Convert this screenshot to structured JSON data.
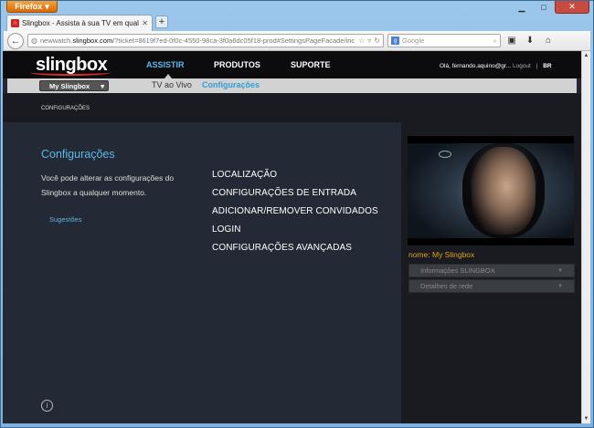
{
  "browser": {
    "app_button": "Firefox",
    "tab_title": "Slingbox - Assista à sua TV em qualquer ...",
    "url_prefix": "newwatch.",
    "url_domain": "slingbox.com",
    "url_path": "/?ticket=8619f7ed-0f0c-4550-98ca-3f0a6dc05f18-prod#SettingsPageFacade/inc",
    "search_placeholder": "Google"
  },
  "header": {
    "logo": "slingbox",
    "nav": [
      "ASSISTIR",
      "PRODUTOS",
      "SUPORTE"
    ],
    "greeting": "Olá, fernando.aquino@gr...",
    "logout": "Logout",
    "separator": "|",
    "language": "BR"
  },
  "subnav": {
    "device_select": "My Slingbox",
    "links": [
      "TV ao Vivo",
      "Configurações"
    ]
  },
  "breadcrumb": "CONFIGURAÇÕES",
  "main": {
    "title": "Configurações",
    "description": "Você pode alterar as configurações do Slingbox a qualquer momento.",
    "suggestions": "Sugestões",
    "menu": [
      "LOCALIZAÇÃO",
      "CONFIGURAÇÕES DE ENTRADA",
      "ADICIONAR/REMOVER CONVIDADOS",
      "LOGIN",
      "CONFIGURAÇÕES AVANÇADAS"
    ]
  },
  "right_panel": {
    "device_name": "nome: My Slingbox",
    "accordions": [
      "Informações SLINGBOX",
      "Detalhes de rede"
    ]
  }
}
